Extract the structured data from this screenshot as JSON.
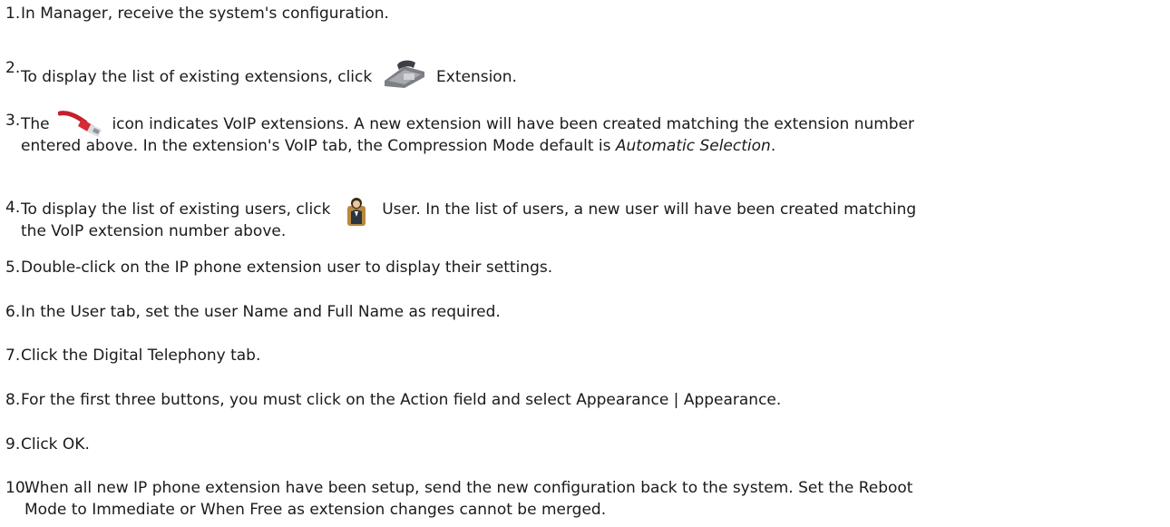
{
  "steps": [
    {
      "num": "1.",
      "text": "In Manager, receive the system's configuration."
    },
    {
      "num": "2.",
      "before": "To display the list of existing extensions, click",
      "after": "Extension.",
      "icon": "phone-icon"
    },
    {
      "num": "3.",
      "before": "The",
      "after": "icon indicates VoIP extensions. A new extension will have been created matching the extension number",
      "line2": "entered above. In the extension's VoIP tab, the Compression Mode default is",
      "line2_italic": "Automatic Selection",
      "line2_end": ".",
      "icon": "network-cable-icon"
    },
    {
      "num": "4.",
      "before": "To display the list of existing users, click",
      "after": "User. In the list of users, a new user will have been created matching",
      "line2": "the VoIP extension number above.",
      "icon": "user-icon"
    },
    {
      "num": "5.",
      "text": "Double-click on the IP phone extension user to display their settings."
    },
    {
      "num": "6.",
      "text": "In the User tab, set the user Name and Full Name as required."
    },
    {
      "num": "7.",
      "text": "Click the Digital Telephony tab."
    },
    {
      "num": "8.",
      "text": "For the first three buttons, you must click on the Action field and select Appearance | Appearance."
    },
    {
      "num": "9.",
      "text": "Click OK."
    },
    {
      "num": "10.",
      "text": "When all new IP phone extension have been setup, send the new configuration back to the system. Set the Reboot",
      "line2": "Mode to Immediate or When Free as extension changes cannot be merged."
    }
  ]
}
